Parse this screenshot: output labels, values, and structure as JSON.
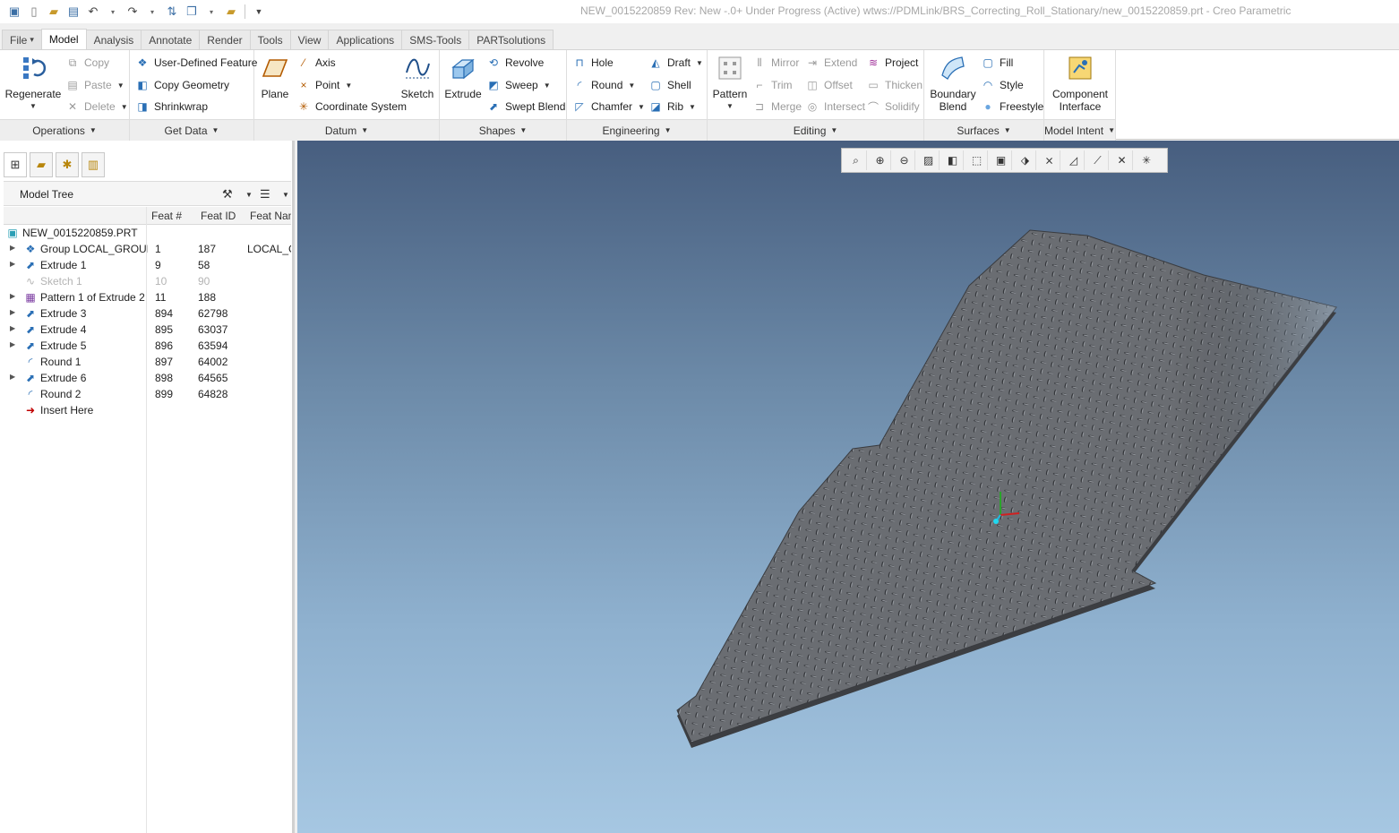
{
  "window": {
    "title": "NEW_0015220859 Rev: New -.0+ Under Progress  (Active) wtws://PDMLink/BRS_Correcting_Roll_Stationary/new_0015220859.prt - Creo Parametric"
  },
  "tabs": [
    {
      "label": "File",
      "dropdown": "▾"
    },
    {
      "label": "Model"
    },
    {
      "label": "Analysis"
    },
    {
      "label": "Annotate"
    },
    {
      "label": "Render"
    },
    {
      "label": "Tools"
    },
    {
      "label": "View"
    },
    {
      "label": "Applications"
    },
    {
      "label": "SMS-Tools"
    },
    {
      "label": "PARTsolutions"
    }
  ],
  "ribbon": {
    "operations": {
      "label": "Operations",
      "regenerate": "Regenerate",
      "copy": "Copy",
      "paste": "Paste",
      "delete": "Delete"
    },
    "getdata": {
      "label": "Get Data",
      "udf": "User-Defined Feature",
      "copy_geometry": "Copy Geometry",
      "shrinkwrap": "Shrinkwrap"
    },
    "datum": {
      "label": "Datum",
      "plane": "Plane",
      "axis": "Axis",
      "point": "Point",
      "csys": "Coordinate System",
      "sketch": "Sketch"
    },
    "shapes": {
      "label": "Shapes",
      "extrude": "Extrude",
      "revolve": "Revolve",
      "sweep": "Sweep",
      "swept_blend": "Swept Blend"
    },
    "engineering": {
      "label": "Engineering",
      "hole": "Hole",
      "round": "Round",
      "chamfer": "Chamfer",
      "draft": "Draft",
      "shell": "Shell",
      "rib": "Rib"
    },
    "editing": {
      "label": "Editing",
      "pattern": "Pattern",
      "mirror": "Mirror",
      "trim": "Trim",
      "merge": "Merge",
      "extend": "Extend",
      "offset": "Offset",
      "intersect": "Intersect",
      "project": "Project",
      "thicken": "Thicken",
      "solidify": "Solidify"
    },
    "surfaces": {
      "label": "Surfaces",
      "boundary_blend_1": "Boundary",
      "boundary_blend_2": "Blend",
      "fill": "Fill",
      "style": "Style",
      "freestyle": "Freestyle"
    },
    "modelintent": {
      "label": "Model Intent",
      "component_interface_1": "Component",
      "component_interface_2": "Interface"
    }
  },
  "model_tree": {
    "title": "Model Tree",
    "columns": [
      "Feat #",
      "Feat ID",
      "Feat Name"
    ],
    "rows": [
      {
        "name": "NEW_0015220859.PRT",
        "feat": "",
        "id": "",
        "fname": "",
        "icon": "part-icon",
        "expand": false,
        "dim": false,
        "indent": 0
      },
      {
        "name": "Group LOCAL_GROUP",
        "feat": "1",
        "id": "187",
        "fname": "LOCAL_GROUP",
        "icon": "group-icon",
        "expand": true,
        "dim": false,
        "indent": 1
      },
      {
        "name": "Extrude 1",
        "feat": "9",
        "id": "58",
        "fname": "",
        "icon": "extrude-icon",
        "expand": true,
        "dim": false,
        "indent": 1
      },
      {
        "name": "Sketch 1",
        "feat": "10",
        "id": "90",
        "fname": "",
        "icon": "sketch-icon",
        "expand": false,
        "dim": true,
        "indent": 1
      },
      {
        "name": "Pattern 1 of Extrude 2",
        "feat": "11",
        "id": "188",
        "fname": "",
        "icon": "pattern-icon",
        "expand": true,
        "dim": false,
        "indent": 1
      },
      {
        "name": "Extrude 3",
        "feat": "894",
        "id": "62798",
        "fname": "",
        "icon": "extrude-icon",
        "expand": true,
        "dim": false,
        "indent": 1
      },
      {
        "name": "Extrude 4",
        "feat": "895",
        "id": "63037",
        "fname": "",
        "icon": "extrude-icon",
        "expand": true,
        "dim": false,
        "indent": 1
      },
      {
        "name": "Extrude 5",
        "feat": "896",
        "id": "63594",
        "fname": "",
        "icon": "extrude-icon",
        "expand": true,
        "dim": false,
        "indent": 1
      },
      {
        "name": "Round 1",
        "feat": "897",
        "id": "64002",
        "fname": "",
        "icon": "round-icon",
        "expand": false,
        "dim": false,
        "indent": 1
      },
      {
        "name": "Extrude 6",
        "feat": "898",
        "id": "64565",
        "fname": "",
        "icon": "extrude-icon",
        "expand": true,
        "dim": false,
        "indent": 1
      },
      {
        "name": "Round 2",
        "feat": "899",
        "id": "64828",
        "fname": "",
        "icon": "round-icon",
        "expand": false,
        "dim": false,
        "indent": 1
      },
      {
        "name": "Insert Here",
        "feat": "",
        "id": "",
        "fname": "",
        "icon": "insert-arrow-icon",
        "expand": false,
        "dim": false,
        "indent": 1
      }
    ]
  },
  "colors": {
    "viewport_top": "#475e7f",
    "viewport_bottom": "#a6c7e2",
    "plate": "#6a6d72",
    "insert_arrow": "#c00000"
  }
}
